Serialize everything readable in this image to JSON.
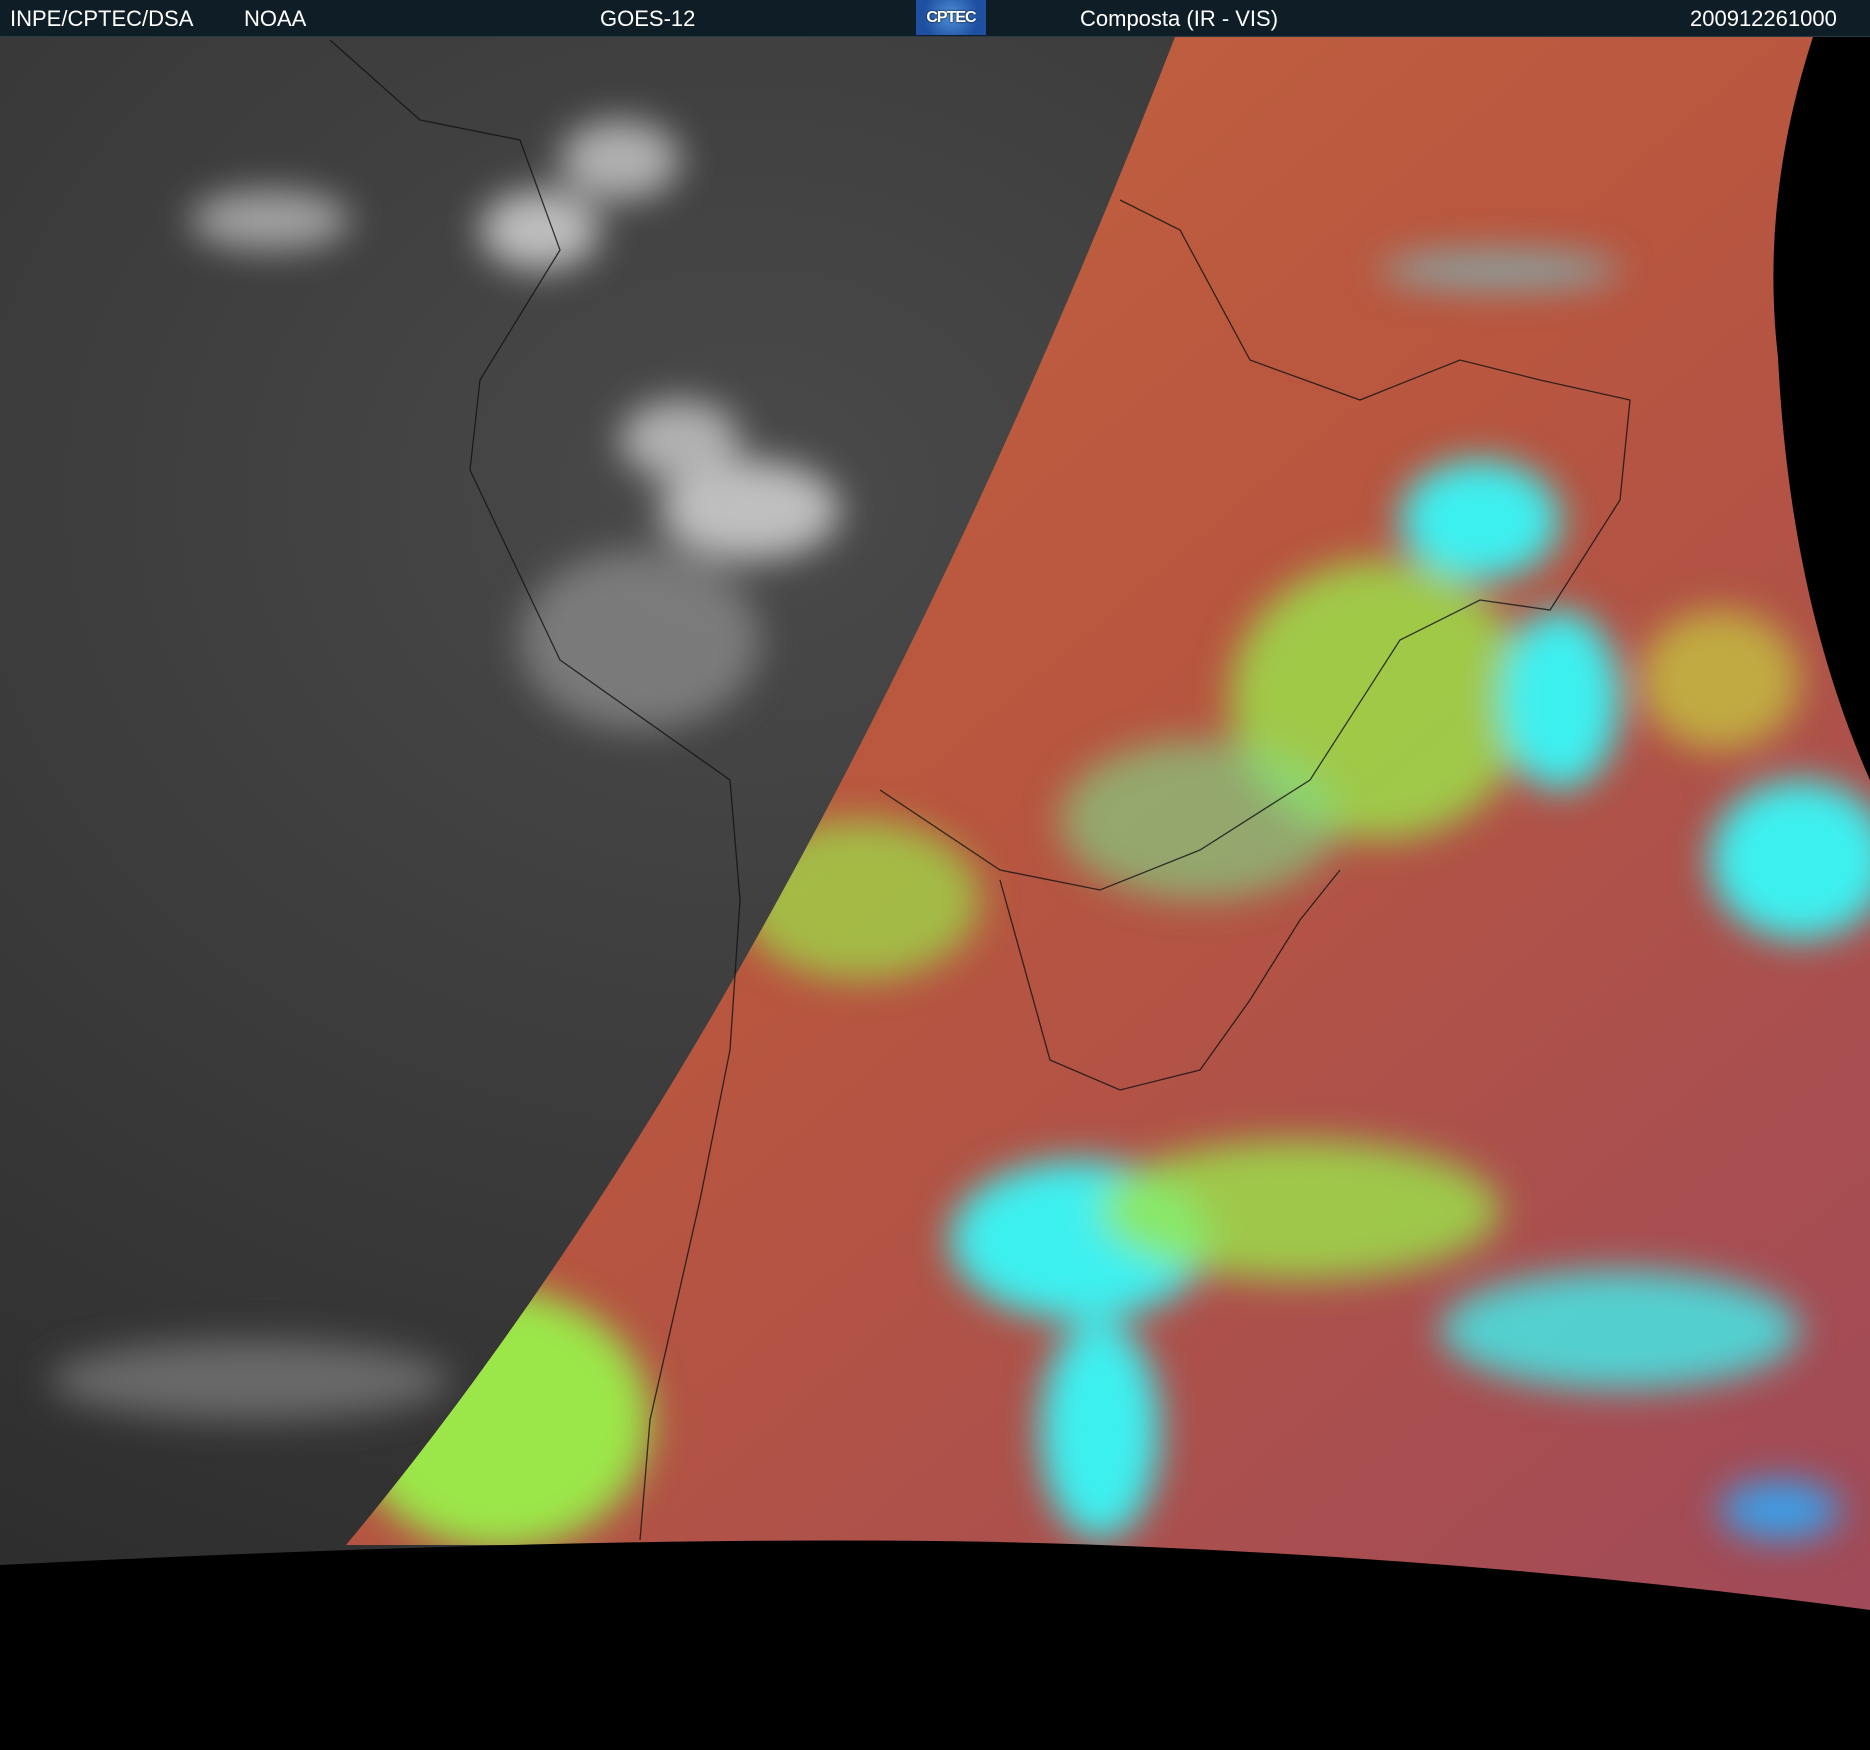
{
  "header": {
    "org": "INPE/CPTEC/DSA",
    "agency": "NOAA",
    "satellite": "GOES-12",
    "logo_text": "CPTEC",
    "product": "Composta (IR - VIS)",
    "timestamp": "200912261000"
  },
  "colors": {
    "header_bg": "#0f1d26",
    "ir_gray": "#3a3a3a",
    "vis_land": "#b85a44",
    "vis_cloud_low": "#9be64a",
    "vis_cloud_high": "#3ef0f0"
  }
}
